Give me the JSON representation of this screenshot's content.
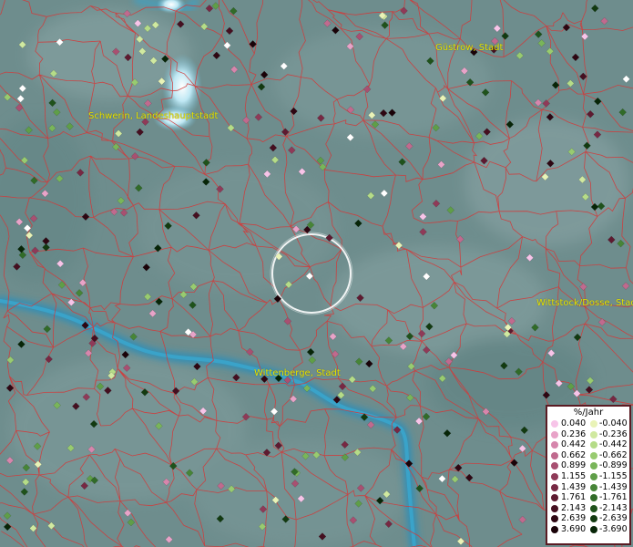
{
  "cities": [
    {
      "id": "guestrow",
      "name": "Güstrow, Stadt"
    },
    {
      "id": "schwerin",
      "name": "Schwerin, Landeshauptstadt"
    },
    {
      "id": "wittstock",
      "name": "Wittstock/Dosse, Stadt"
    },
    {
      "id": "wittenberge",
      "name": "Wittenberge, Stadt"
    }
  ],
  "legend": {
    "title": "%/Jahr",
    "rows": [
      {
        "pos": "0.040",
        "neg": "-0.040",
        "pos_color": "#f7c4e8",
        "neg_color": "#e9f3b7"
      },
      {
        "pos": "0.236",
        "neg": "-0.236",
        "pos_color": "#e8a3c8",
        "neg_color": "#d0e9a0"
      },
      {
        "pos": "0.442",
        "neg": "-0.442",
        "pos_color": "#d686ac",
        "neg_color": "#b5dc88"
      },
      {
        "pos": "0.662",
        "neg": "-0.662",
        "pos_color": "#c06a8e",
        "neg_color": "#98cb70"
      },
      {
        "pos": "0.899",
        "neg": "-0.899",
        "pos_color": "#a85071",
        "neg_color": "#79b55a"
      },
      {
        "pos": "1.155",
        "neg": "-1.155",
        "pos_color": "#8f3a58",
        "neg_color": "#5f9e48"
      },
      {
        "pos": "1.439",
        "neg": "-1.439",
        "pos_color": "#772843",
        "neg_color": "#478537"
      },
      {
        "pos": "1.761",
        "neg": "-1.761",
        "pos_color": "#5e1a30",
        "neg_color": "#316b28"
      },
      {
        "pos": "2.143",
        "neg": "-2.143",
        "pos_color": "#450f20",
        "neg_color": "#1f521b"
      },
      {
        "pos": "2.639",
        "neg": "-2.639",
        "pos_color": "#2e0612",
        "neg_color": "#123a10"
      },
      {
        "pos": "3.690",
        "neg": "-3.690",
        "pos_color": "#1a0208",
        "neg_color": "#072507"
      }
    ]
  },
  "colors": {
    "background": "#6e8d8d",
    "boundary": "#d23a3a",
    "river": "#2f8fb8",
    "highlight": "#ffffff",
    "city_label": "#e6e600"
  }
}
